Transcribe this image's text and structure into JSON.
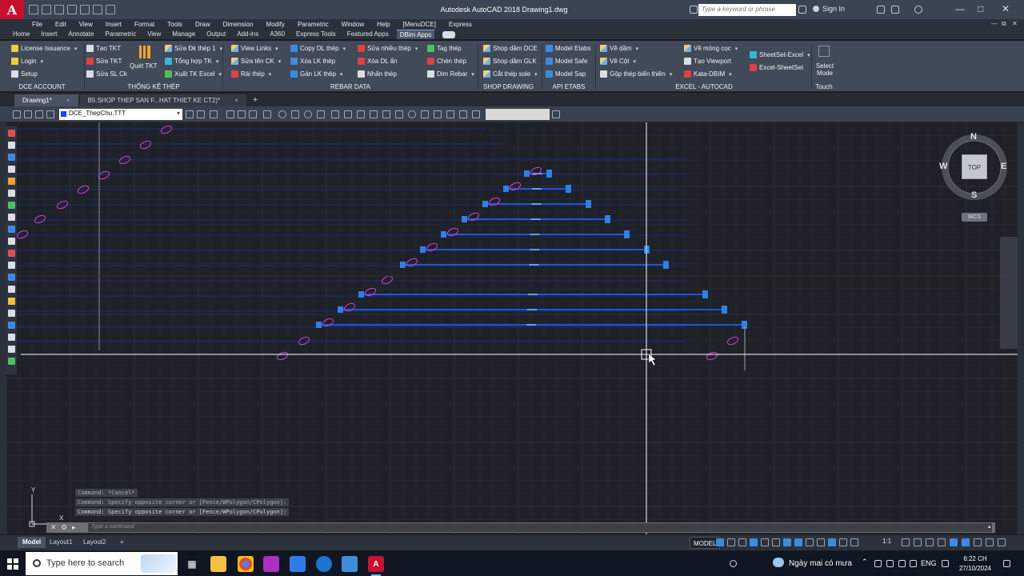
{
  "titlebar": {
    "logo": "A",
    "title": "Autodesk AutoCAD 2018    Drawing1.dwg",
    "search_placeholder": "Type a keyword or phrase",
    "signin": "Sign In"
  },
  "menu": [
    "File",
    "Edit",
    "View",
    "Insert",
    "Format",
    "Tools",
    "Draw",
    "Dimension",
    "Modify",
    "Parametric",
    "Window",
    "Help",
    "[MenuDCE]",
    "Express"
  ],
  "ribbon_tabs": [
    "Home",
    "Insert",
    "Annotate",
    "Parametric",
    "View",
    "Manage",
    "Output",
    "Add-ins",
    "A360",
    "Express Tools",
    "Featured Apps",
    "DBim Apps"
  ],
  "ribbon_active_tab": "DBim Apps",
  "ribbon": {
    "dce_account": {
      "title": "DCE ACCOUNT",
      "items": [
        "License Issuance",
        "Login",
        "Setup"
      ]
    },
    "thong_ke": {
      "title": "THỐNG KÊ THÉP",
      "col1": [
        "Tạo TKT",
        "Sửa TKT",
        "Sửa SL Ck"
      ],
      "big": "Quét TKT",
      "col2": [
        "Sửa Đk thép 1",
        "Tổng hợp TK",
        "Xuất TK Excel"
      ]
    },
    "rebar_data": {
      "title": "REBAR DATA",
      "col1": [
        "View Links",
        "Sửa tên CK",
        "Rải thép"
      ],
      "col2": [
        "Copy DL thép",
        "Xóa LK thép",
        "Gán LK thép"
      ],
      "col3": [
        "Sửa nhiều thép",
        "Xóa DL ẩn",
        "Nhấn thép"
      ]
    },
    "shop_drawing": {
      "title": "SHOP DRAWING",
      "col1": [
        "Tag thép",
        "Chèn thép",
        "Dim Rebar"
      ],
      "col2": [
        "Shop dầm DCE",
        "Shop dầm GLK",
        "Cắt thép sole"
      ]
    },
    "api_etabs": {
      "title": "API ETABS",
      "items": [
        "Model Etabs",
        "Model Safe",
        "Model Sap"
      ]
    },
    "excel_autocad": {
      "title": "EXCEL - AUTOCAD",
      "col1": [
        "Vẽ dầm",
        "Vẽ Cột",
        "Gộp thép biến thiên"
      ],
      "col2": [
        "Vẽ móng cọc",
        "Tạo Viewport",
        "Kata-DBIM"
      ],
      "col3": [
        "SheetSet-Excel",
        "Excel-SheetSet"
      ]
    },
    "touch": {
      "title": "Touch",
      "label": "Select Mode"
    }
  },
  "doc_tabs": [
    "Drawing1*",
    "B5.SHOP THEP SAN F...HAT THIET KE CT2)*"
  ],
  "layer": {
    "name": "DCE_ThepChu.TTT"
  },
  "viewcube": {
    "top_face": "TOP",
    "n": "N",
    "s": "S",
    "e": "E",
    "w": "W",
    "wcs": "WCS"
  },
  "command": {
    "history": [
      "Command: *Cancel*",
      "Command: Specify opposite corner or [Fence/WPolygon/CPolygon]:",
      "Command: Specify opposite corner or [Fence/WPolygon/CPolygon]:"
    ],
    "placeholder": "Type a command"
  },
  "layout_tabs": [
    "Model",
    "Layout1",
    "Layout2"
  ],
  "status": {
    "model": "MODEL",
    "scale": "1:1"
  },
  "ucs": {
    "x": "X",
    "y": "Y"
  },
  "taskbar": {
    "search_placeholder": "Type here to search",
    "weather": "Ngày mai có mưa",
    "lang": "ENG",
    "time": "6:22 CH",
    "date": "27/10/2024"
  },
  "colors": {
    "rebar_blue": "#1a55d8",
    "grip_blue": "#2f7fe6",
    "magenta": "#d040d0",
    "crosshair": "#ffffff"
  }
}
